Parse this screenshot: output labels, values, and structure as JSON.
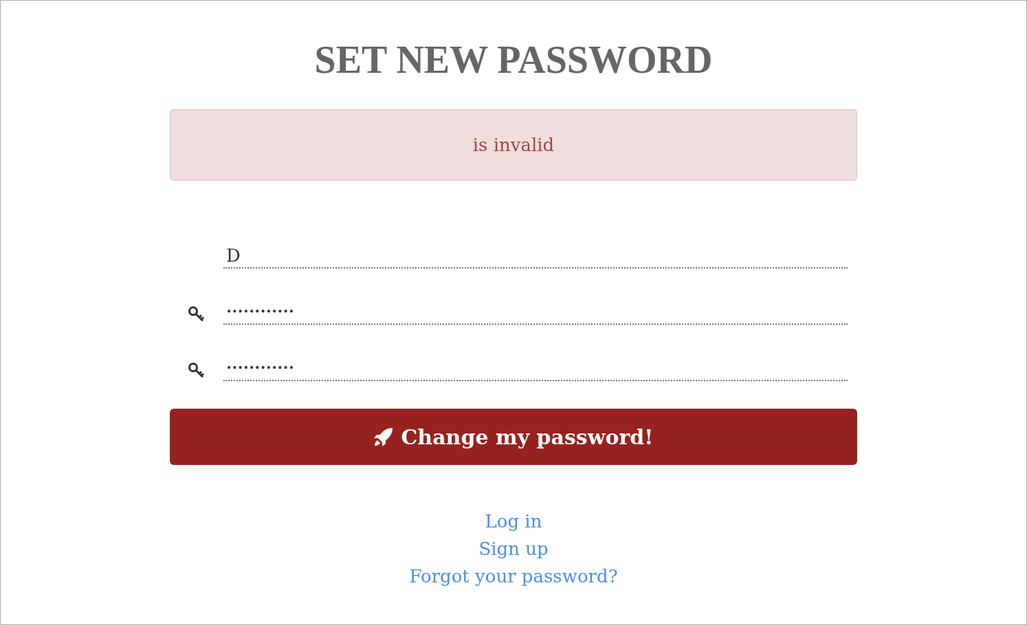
{
  "title": "SET NEW PASSWORD",
  "alert": {
    "message": "is invalid"
  },
  "fields": [
    {
      "kind": "text",
      "value": "D"
    },
    {
      "kind": "password",
      "value": "••••••••••••"
    },
    {
      "kind": "password",
      "value": "••••••••••••"
    }
  ],
  "submit": {
    "label": "Change my password!"
  },
  "links": [
    "Log in",
    "Sign up",
    "Forgot your password?"
  ]
}
